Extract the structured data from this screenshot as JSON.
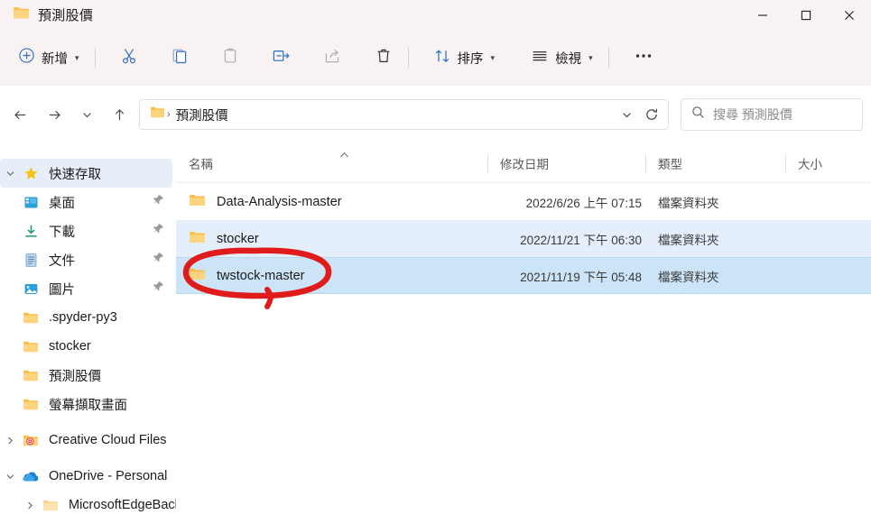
{
  "window": {
    "title": "預測股價",
    "folder_icon": "folder-icon",
    "controls": {
      "minimize": "minimize-icon",
      "maximize": "maximize-icon",
      "close": "close-icon"
    }
  },
  "toolbar": {
    "new_label": "新增",
    "new_icon": "plus-circle-icon",
    "cut_icon": "scissors-icon",
    "copy_icon": "copy-icon",
    "paste_icon": "paste-icon",
    "rename_icon": "rename-icon",
    "share_icon": "share-icon",
    "delete_icon": "trash-icon",
    "sort_label": "排序",
    "sort_icon": "sort-arrows-icon",
    "view_label": "檢視",
    "view_icon": "view-lines-icon",
    "more_label": "···",
    "more_icon": "ellipsis-icon"
  },
  "navigation": {
    "back_icon": "arrow-left-icon",
    "forward_icon": "arrow-right-icon",
    "recent_icon": "chevron-down-icon",
    "up_icon": "arrow-up-icon",
    "address": {
      "folder_icon": "folder-icon",
      "separator": "›",
      "crumb": "預測股價",
      "dropdown_icon": "chevron-down-icon",
      "refresh_icon": "refresh-icon"
    },
    "search": {
      "icon": "search-icon",
      "placeholder": "搜尋 預測股價"
    }
  },
  "sidebar": {
    "items": [
      {
        "label": "快速存取",
        "icon": "star-icon",
        "chevron": "expanded",
        "indent": 0,
        "pinned": false,
        "selected": true
      },
      {
        "label": "桌面",
        "icon": "desktop-icon",
        "chevron": "none",
        "indent": 1,
        "pinned": true,
        "selected": false
      },
      {
        "label": "下載",
        "icon": "download-icon",
        "chevron": "none",
        "indent": 1,
        "pinned": true,
        "selected": false
      },
      {
        "label": "文件",
        "icon": "document-icon",
        "chevron": "none",
        "indent": 1,
        "pinned": true,
        "selected": false
      },
      {
        "label": "圖片",
        "icon": "pictures-icon",
        "chevron": "none",
        "indent": 1,
        "pinned": true,
        "selected": false
      },
      {
        "label": ".spyder-py3",
        "icon": "folder-icon",
        "chevron": "none",
        "indent": 1,
        "pinned": false,
        "selected": false
      },
      {
        "label": "stocker",
        "icon": "folder-icon",
        "chevron": "none",
        "indent": 1,
        "pinned": false,
        "selected": false
      },
      {
        "label": "預測股價",
        "icon": "folder-icon",
        "chevron": "none",
        "indent": 1,
        "pinned": false,
        "selected": false
      },
      {
        "label": "螢幕擷取畫面",
        "icon": "folder-icon",
        "chevron": "none",
        "indent": 1,
        "pinned": false,
        "selected": false
      },
      {
        "label": "Creative Cloud Files",
        "icon": "creative-cloud-icon",
        "chevron": "collapsed",
        "indent": 0,
        "pinned": false,
        "selected": false
      },
      {
        "label": "OneDrive - Personal",
        "icon": "onedrive-icon",
        "chevron": "expanded",
        "indent": 0,
        "pinned": false,
        "selected": false
      },
      {
        "label": "MicrosoftEdgeBacl",
        "icon": "folder-icon",
        "chevron": "collapsed",
        "indent": 1,
        "pinned": false,
        "selected": false
      }
    ]
  },
  "filelist": {
    "columns": [
      {
        "label": "名稱",
        "sorted": "ascending"
      },
      {
        "label": "修改日期",
        "sorted": "none"
      },
      {
        "label": "類型",
        "sorted": "none"
      },
      {
        "label": "大小",
        "sorted": "none"
      }
    ],
    "rows": [
      {
        "name": "Data-Analysis-master",
        "icon": "folder-icon",
        "date": "2022/6/26 上午 07:15",
        "type": "檔案資料夾",
        "size": "",
        "highlight": "none"
      },
      {
        "name": "stocker",
        "icon": "folder-icon",
        "date": "2022/11/21 下午 06:30",
        "type": "檔案資料夾",
        "size": "",
        "highlight": "light"
      },
      {
        "name": "twstock-master",
        "icon": "folder-icon",
        "date": "2021/11/19 下午 05:48",
        "type": "檔案資料夾",
        "size": "",
        "highlight": "strong"
      }
    ]
  },
  "annotation": {
    "shape": "red-ellipse-highlight",
    "target": "twstock-master",
    "color": "#e01b1b"
  }
}
